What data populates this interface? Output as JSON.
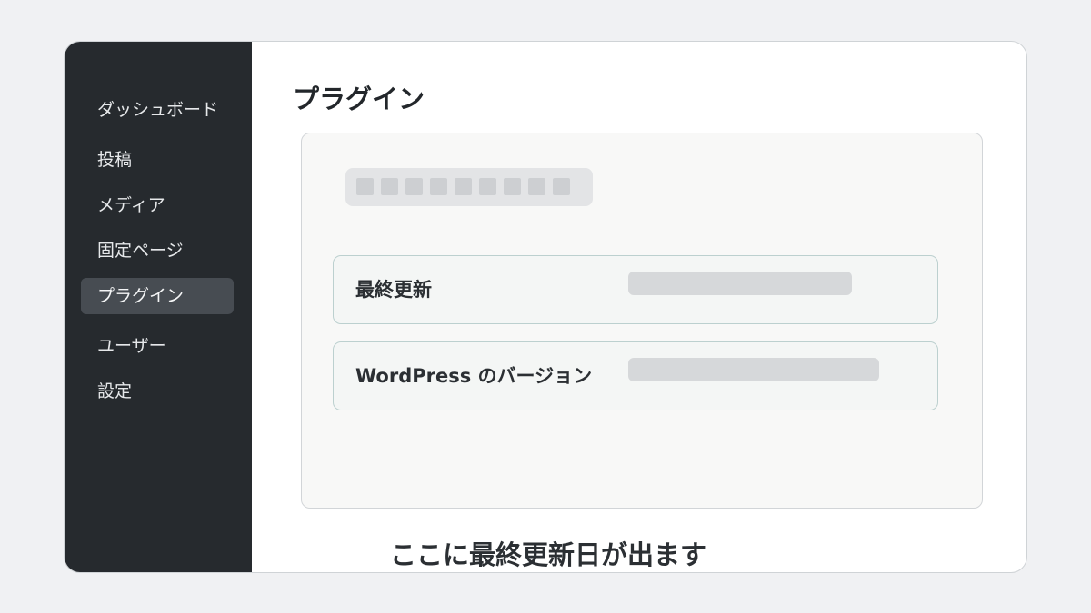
{
  "sidebar": {
    "items": [
      {
        "label": "ダッシュボード"
      },
      {
        "label": "投稿"
      },
      {
        "label": "メディア"
      },
      {
        "label": "固定ページ"
      },
      {
        "label": "プラグイン",
        "active": true
      },
      {
        "label": "ユーザー"
      },
      {
        "label": "設定"
      }
    ]
  },
  "main": {
    "title": "プラグイン",
    "rows": [
      {
        "label": "最終更新"
      },
      {
        "label": "WordPress のバージョン"
      }
    ],
    "caption": "ここに最終更新日が出ます"
  },
  "colors": {
    "sidebar_bg": "#262a2e",
    "sidebar_active_bg": "#474c52",
    "panel_bg": "#f8f8f7",
    "row_border": "#bcd0cf"
  }
}
